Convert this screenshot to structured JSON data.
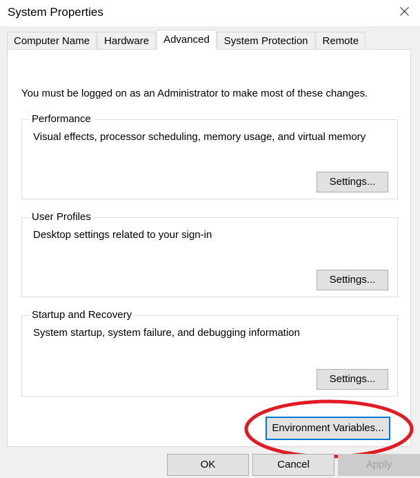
{
  "window": {
    "title": "System Properties",
    "close_icon": "close-icon"
  },
  "tabs": [
    {
      "label": "Computer Name",
      "active": false
    },
    {
      "label": "Hardware",
      "active": false
    },
    {
      "label": "Advanced",
      "active": true
    },
    {
      "label": "System Protection",
      "active": false
    },
    {
      "label": "Remote",
      "active": false
    }
  ],
  "content": {
    "admin_note": "You must be logged on as an Administrator to make most of these changes.",
    "groups": [
      {
        "title": "Performance",
        "description": "Visual effects, processor scheduling, memory usage, and virtual memory",
        "button_label": "Settings..."
      },
      {
        "title": "User Profiles",
        "description": "Desktop settings related to your sign-in",
        "button_label": "Settings..."
      },
      {
        "title": "Startup and Recovery",
        "description": "System startup, system failure, and debugging information",
        "button_label": "Settings..."
      }
    ],
    "environment_variables_button": {
      "label": "Environment Variables...",
      "focused": true
    }
  },
  "annotation": {
    "shape": "ellipse",
    "color": "#e11b22",
    "target": "Environment Variables..."
  },
  "footer": {
    "ok_label": "OK",
    "cancel_label": "Cancel",
    "apply_label": "Apply",
    "apply_disabled": true
  },
  "colors": {
    "accent_focus": "#0078d7",
    "dialog_background": "#f0f0f0",
    "panel_background": "#ffffff",
    "button_face": "#e1e1e1",
    "button_border": "#adadad",
    "annotation_red": "#e11b22"
  }
}
